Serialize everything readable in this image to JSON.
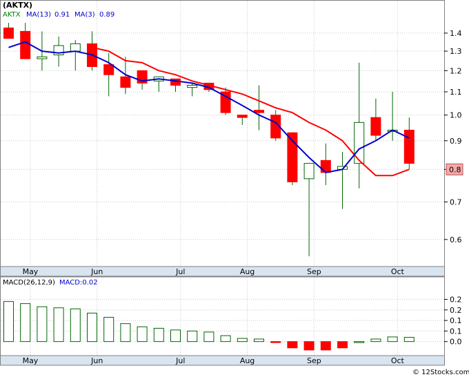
{
  "header": {
    "ticker": "(AKTX)",
    "ma13_label": "MA(13)",
    "ma13_value": "0.91",
    "ma3_label": "MA(3)",
    "ma3_value": "0.89"
  },
  "price_tag": "0.8",
  "macd_header": {
    "label": "MACD(26,12,9)",
    "value_label": "MACD:0.02"
  },
  "credit": "© 12Stocks.com",
  "colors": {
    "up_body": "#ffffff",
    "up_outline": "#006400",
    "down_body": "#ff0000",
    "wick": "#006400",
    "ma13": "#ff0000",
    "ma3": "#0000cc",
    "grid": "#c8c8c8",
    "axis_band": "#d8e4f0",
    "price_tag_bg": "#f4aaaa",
    "macd_bar_outline": "#006400",
    "macd_bar_neg": "#ff0000",
    "header_ticker": "#000000",
    "header_ma13_label": "#008000",
    "header_ma3_label": "#0000cc"
  },
  "chart_data": [
    {
      "type": "candlestick",
      "scale": "log",
      "ylim": [
        0.54,
        1.55
      ],
      "y_ticks": [
        "0.6",
        "0.7",
        "0.8",
        "0.9",
        "1.0",
        "1.1",
        "1.2",
        "1.3",
        "1.4"
      ],
      "x_ticks": [
        "May",
        "Jun",
        "Jul",
        "Aug",
        "Sep",
        "Oct"
      ],
      "x_tick_index": [
        1.3,
        5.3,
        10.3,
        14.3,
        18.3,
        23.3
      ],
      "candles": [
        {
          "o": 1.43,
          "h": 1.46,
          "l": 1.38,
          "c": 1.37
        },
        {
          "o": 1.41,
          "h": 1.46,
          "l": 1.26,
          "c": 1.26
        },
        {
          "o": 1.26,
          "h": 1.41,
          "l": 1.2,
          "c": 1.27
        },
        {
          "o": 1.28,
          "h": 1.38,
          "l": 1.22,
          "c": 1.33
        },
        {
          "o": 1.3,
          "h": 1.36,
          "l": 1.2,
          "c": 1.34
        },
        {
          "o": 1.34,
          "h": 1.41,
          "l": 1.2,
          "c": 1.22
        },
        {
          "o": 1.23,
          "h": 1.29,
          "l": 1.08,
          "c": 1.18
        },
        {
          "o": 1.17,
          "h": 1.27,
          "l": 1.09,
          "c": 1.12
        },
        {
          "o": 1.2,
          "h": 1.2,
          "l": 1.11,
          "c": 1.14
        },
        {
          "o": 1.15,
          "h": 1.17,
          "l": 1.1,
          "c": 1.17
        },
        {
          "o": 1.16,
          "h": 1.16,
          "l": 1.1,
          "c": 1.13
        },
        {
          "o": 1.12,
          "h": 1.14,
          "l": 1.08,
          "c": 1.13
        },
        {
          "o": 1.14,
          "h": 1.14,
          "l": 1.1,
          "c": 1.11
        },
        {
          "o": 1.1,
          "h": 1.12,
          "l": 1.0,
          "c": 1.01
        },
        {
          "o": 1.0,
          "h": 1.0,
          "l": 0.96,
          "c": 0.99
        },
        {
          "o": 1.02,
          "h": 1.13,
          "l": 0.94,
          "c": 1.01
        },
        {
          "o": 1.0,
          "h": 1.02,
          "l": 0.9,
          "c": 0.91
        },
        {
          "o": 0.93,
          "h": 0.93,
          "l": 0.75,
          "c": 0.76
        },
        {
          "o": 0.77,
          "h": 0.82,
          "l": 0.56,
          "c": 0.82
        },
        {
          "o": 0.83,
          "h": 0.89,
          "l": 0.75,
          "c": 0.79
        },
        {
          "o": 0.8,
          "h": 0.86,
          "l": 0.68,
          "c": 0.81
        },
        {
          "o": 0.82,
          "h": 1.24,
          "l": 0.74,
          "c": 0.97
        },
        {
          "o": 0.99,
          "h": 1.07,
          "l": 0.9,
          "c": 0.92
        },
        {
          "o": 0.94,
          "h": 1.1,
          "l": 0.9,
          "c": 0.94
        },
        {
          "o": 0.94,
          "h": 0.99,
          "l": 0.8,
          "c": 0.82
        }
      ],
      "ma13": [
        {
          "x": 5.0,
          "y": 1.32
        },
        {
          "x": 6.0,
          "y": 1.3
        },
        {
          "x": 7.0,
          "y": 1.25
        },
        {
          "x": 8.0,
          "y": 1.24
        },
        {
          "x": 9.0,
          "y": 1.2
        },
        {
          "x": 10.0,
          "y": 1.18
        },
        {
          "x": 11.0,
          "y": 1.15
        },
        {
          "x": 12.0,
          "y": 1.13
        },
        {
          "x": 13.0,
          "y": 1.11
        },
        {
          "x": 14.0,
          "y": 1.09
        },
        {
          "x": 15.0,
          "y": 1.06
        },
        {
          "x": 16.0,
          "y": 1.03
        },
        {
          "x": 17.0,
          "y": 1.01
        },
        {
          "x": 18.0,
          "y": 0.97
        },
        {
          "x": 19.0,
          "y": 0.94
        },
        {
          "x": 20.0,
          "y": 0.9
        },
        {
          "x": 21.0,
          "y": 0.83
        },
        {
          "x": 22.0,
          "y": 0.78
        },
        {
          "x": 23.0,
          "y": 0.78
        },
        {
          "x": 24.0,
          "y": 0.8
        }
      ],
      "ma3": [
        {
          "x": 0.0,
          "y": 1.32
        },
        {
          "x": 1.0,
          "y": 1.35
        },
        {
          "x": 2.0,
          "y": 1.3
        },
        {
          "x": 3.0,
          "y": 1.29
        },
        {
          "x": 4.0,
          "y": 1.3
        },
        {
          "x": 5.0,
          "y": 1.28
        },
        {
          "x": 6.0,
          "y": 1.24
        },
        {
          "x": 7.0,
          "y": 1.18
        },
        {
          "x": 8.0,
          "y": 1.15
        },
        {
          "x": 9.0,
          "y": 1.16
        },
        {
          "x": 10.0,
          "y": 1.15
        },
        {
          "x": 11.0,
          "y": 1.14
        },
        {
          "x": 12.0,
          "y": 1.12
        },
        {
          "x": 13.0,
          "y": 1.08
        },
        {
          "x": 14.0,
          "y": 1.04
        },
        {
          "x": 15.0,
          "y": 1.0
        },
        {
          "x": 16.0,
          "y": 0.97
        },
        {
          "x": 17.0,
          "y": 0.9
        },
        {
          "x": 18.0,
          "y": 0.84
        },
        {
          "x": 19.0,
          "y": 0.79
        },
        {
          "x": 20.0,
          "y": 0.8
        },
        {
          "x": 21.0,
          "y": 0.87
        },
        {
          "x": 22.0,
          "y": 0.9
        },
        {
          "x": 23.0,
          "y": 0.94
        },
        {
          "x": 24.0,
          "y": 0.91
        }
      ],
      "last_price": 0.8
    },
    {
      "type": "bar",
      "name": "MACD(26,12,9)",
      "ylim": [
        -0.06,
        0.3
      ],
      "y_ticks": [
        "0.0",
        "0.1",
        "0.1",
        "0.2",
        "0.2"
      ],
      "y_tick_values": [
        0.0,
        0.05,
        0.1,
        0.15,
        0.2
      ],
      "x_ticks": [
        "May",
        "Jun",
        "Jul",
        "Aug",
        "Sep",
        "Oct"
      ],
      "x_tick_index": [
        1.3,
        5.3,
        10.3,
        14.3,
        18.3,
        23.3
      ],
      "values": [
        0.19,
        0.18,
        0.165,
        0.16,
        0.155,
        0.135,
        0.115,
        0.085,
        0.07,
        0.063,
        0.055,
        0.05,
        0.045,
        0.028,
        0.015,
        0.012,
        -0.005,
        -0.03,
        -0.04,
        -0.04,
        -0.03,
        0.0,
        0.012,
        0.022,
        0.02
      ]
    }
  ]
}
